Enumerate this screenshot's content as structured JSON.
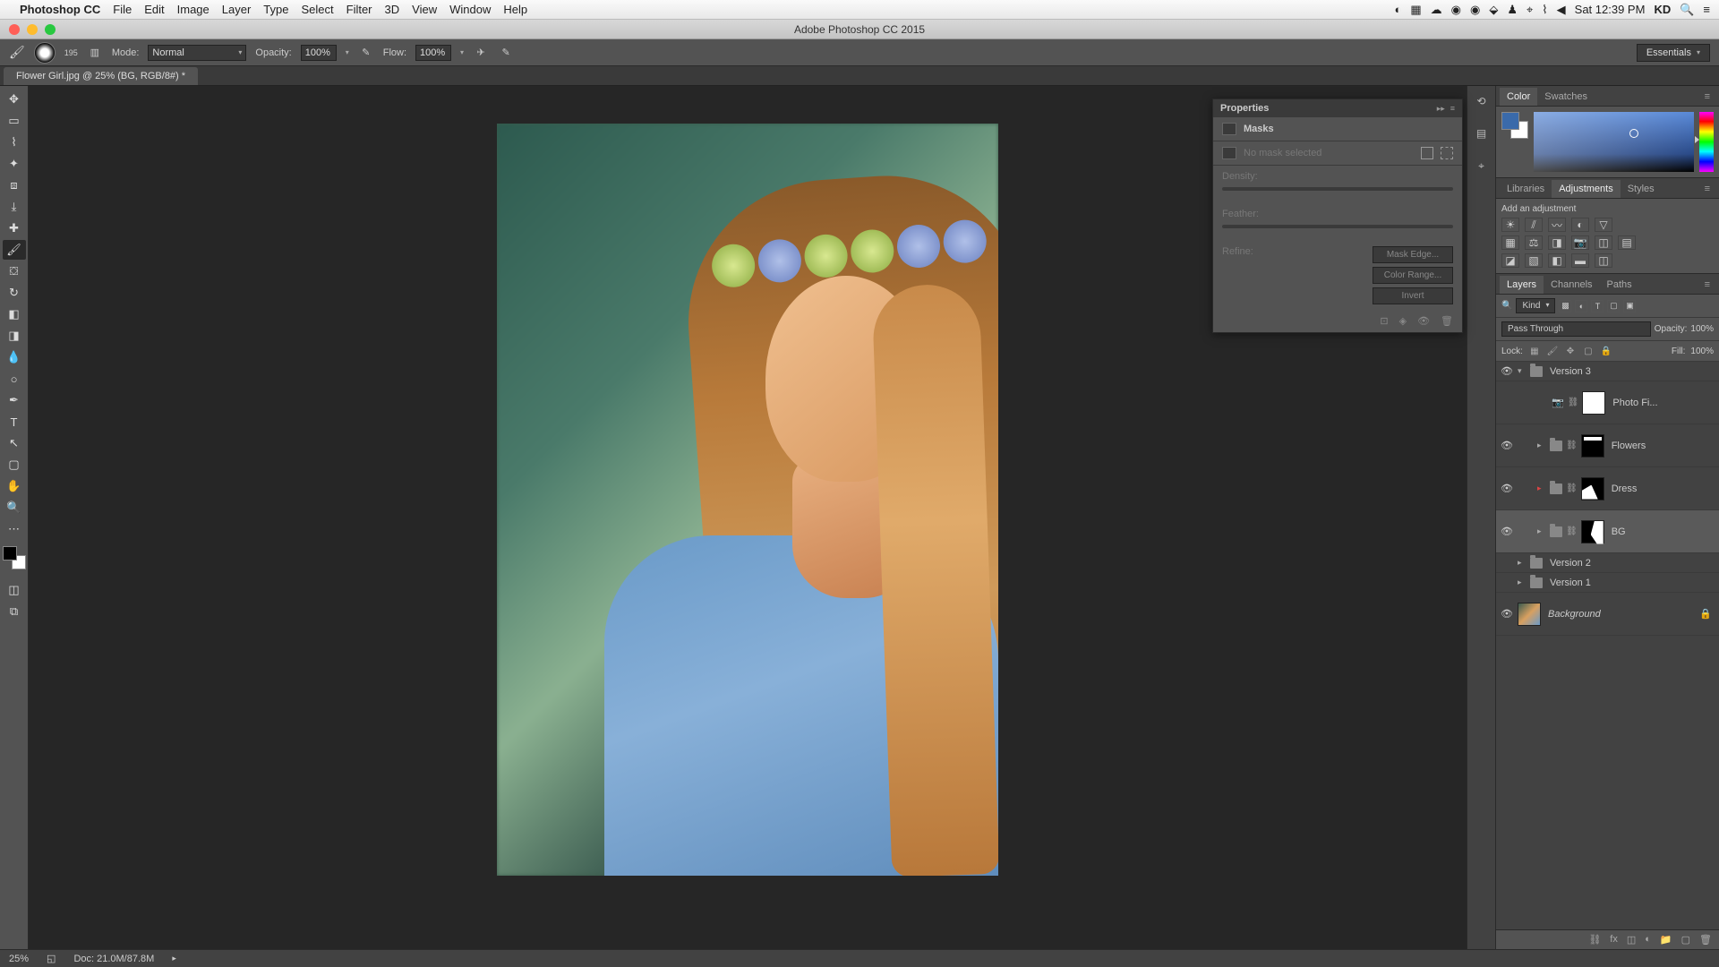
{
  "macmenu": {
    "app": "Photoshop CC",
    "items": [
      "File",
      "Edit",
      "Image",
      "Layer",
      "Type",
      "Select",
      "Filter",
      "3D",
      "View",
      "Window",
      "Help"
    ],
    "clock": "Sat 12:39 PM",
    "user": "KD"
  },
  "window": {
    "title": "Adobe Photoshop CC 2015"
  },
  "options": {
    "brush_size": "195",
    "mode_label": "Mode:",
    "mode_value": "Normal",
    "opacity_label": "Opacity:",
    "opacity_value": "100%",
    "flow_label": "Flow:",
    "flow_value": "100%",
    "workspace": "Essentials"
  },
  "doc_tab": "Flower Girl.jpg @ 25% (BG, RGB/8#) *",
  "properties": {
    "title": "Properties",
    "section": "Masks",
    "no_mask": "No mask selected",
    "density": "Density:",
    "feather": "Feather:",
    "refine": "Refine:",
    "mask_edge": "Mask Edge...",
    "color_range": "Color Range...",
    "invert": "Invert"
  },
  "panels": {
    "color_tab": "Color",
    "swatches_tab": "Swatches",
    "libraries_tab": "Libraries",
    "adjustments_tab": "Adjustments",
    "styles_tab": "Styles",
    "add_adjustment": "Add an adjustment",
    "layers_tab": "Layers",
    "channels_tab": "Channels",
    "paths_tab": "Paths"
  },
  "layers": {
    "kind_label": "Kind",
    "blend_mode": "Pass Through",
    "opacity_label": "Opacity:",
    "opacity_value": "100%",
    "lock_label": "Lock:",
    "fill_label": "Fill:",
    "fill_value": "100%",
    "items": [
      {
        "name": "Version 3",
        "type": "group",
        "expanded": true
      },
      {
        "name": "Photo Fi...",
        "type": "adjustment"
      },
      {
        "name": "Flowers",
        "type": "group-mask"
      },
      {
        "name": "Dress",
        "type": "group-mask"
      },
      {
        "name": "BG",
        "type": "group-mask",
        "selected": true
      },
      {
        "name": "Version 2",
        "type": "group",
        "collapsed": true
      },
      {
        "name": "Version 1",
        "type": "group",
        "collapsed": true
      },
      {
        "name": "Background",
        "type": "bg"
      }
    ]
  },
  "status": {
    "zoom": "25%",
    "doc": "Doc: 21.0M/87.8M"
  }
}
